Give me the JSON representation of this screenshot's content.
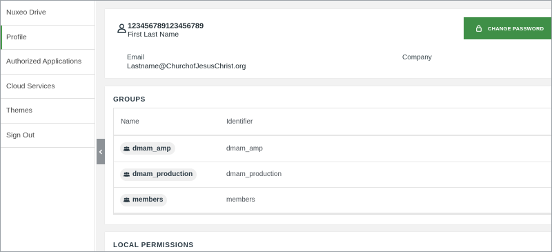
{
  "sidebar": {
    "items": [
      {
        "label": "Nuxeo Drive"
      },
      {
        "label": "Profile"
      },
      {
        "label": "Authorized Applications"
      },
      {
        "label": "Cloud Services"
      },
      {
        "label": "Themes"
      },
      {
        "label": "Sign Out"
      }
    ],
    "active": "Profile"
  },
  "profile": {
    "user_id": "123456789123456789",
    "full_name": "First Last Name",
    "email_label": "Email",
    "email_value": "Lastname@ChurchofJesusChrist.org",
    "company_label": "Company",
    "change_password_label": "CHANGE PASSWORD"
  },
  "groups": {
    "title": "GROUPS",
    "columns": {
      "name": "Name",
      "identifier": "Identifier"
    },
    "rows": [
      {
        "name": "dmam_amp",
        "identifier": "dmam_amp"
      },
      {
        "name": "dmam_production",
        "identifier": "dmam_production"
      },
      {
        "name": "members",
        "identifier": "members"
      }
    ]
  },
  "local_permissions": {
    "title": "LOCAL PERMISSIONS"
  },
  "colors": {
    "accent_green": "#3f8f47",
    "background": "#f2f2f2"
  }
}
